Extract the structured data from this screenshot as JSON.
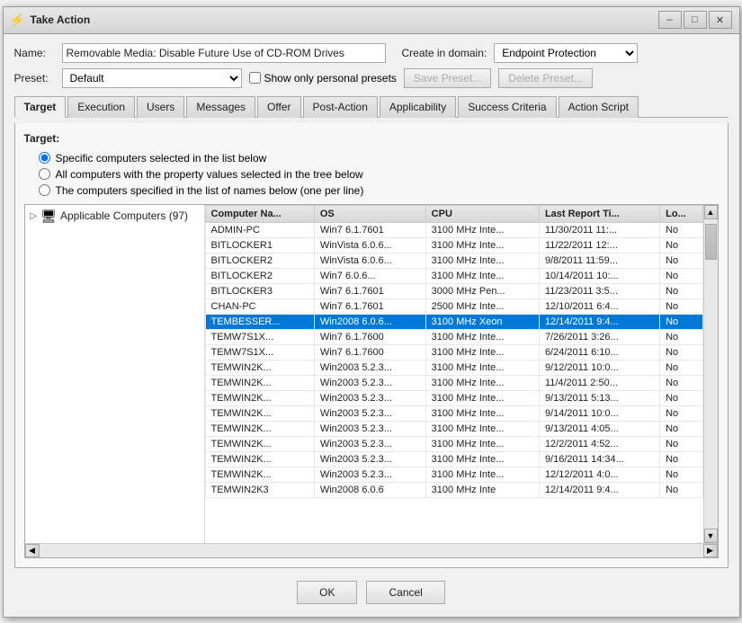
{
  "window": {
    "title": "Take Action",
    "icon": "⚡"
  },
  "form": {
    "name_label": "Name:",
    "name_value": "Removable Media: Disable Future Use of CD-ROM Drives",
    "domain_label": "Create in domain:",
    "domain_value": "Endpoint Protection",
    "preset_label": "Preset:",
    "preset_value": "Default",
    "show_personal_label": "Show only personal presets",
    "save_preset_label": "Save Preset...",
    "delete_preset_label": "Delete Preset..."
  },
  "tabs": [
    {
      "id": "target",
      "label": "Target",
      "active": true
    },
    {
      "id": "execution",
      "label": "Execution",
      "active": false
    },
    {
      "id": "users",
      "label": "Users",
      "active": false
    },
    {
      "id": "messages",
      "label": "Messages",
      "active": false
    },
    {
      "id": "offer",
      "label": "Offer",
      "active": false
    },
    {
      "id": "post-action",
      "label": "Post-Action",
      "active": false
    },
    {
      "id": "applicability",
      "label": "Applicability",
      "active": false
    },
    {
      "id": "success-criteria",
      "label": "Success Criteria",
      "active": false
    },
    {
      "id": "action-script",
      "label": "Action Script",
      "active": false
    }
  ],
  "target_tab": {
    "section_label": "Target:",
    "radio1": "Specific computers selected in the list below",
    "radio2": "All computers with the property values selected in the tree below",
    "radio3": "The computers specified in the list of names below (one per line)",
    "tree": {
      "node_label": "Applicable Computers (97)",
      "expand_icon": "▷",
      "folder_icon": "🖥"
    },
    "table": {
      "columns": [
        "Computer Na...",
        "OS",
        "CPU",
        "Last Report Ti...",
        "Lo..."
      ],
      "rows": [
        {
          "computer": "ADMIN-PC",
          "os": "Win7 6.1.7601",
          "cpu": "3100 MHz Inte...",
          "last_report": "11/30/2011 11:...",
          "lo": "No",
          "highlight": false
        },
        {
          "computer": "BITLOCKER1",
          "os": "WinVista 6.0.6...",
          "cpu": "3100 MHz Inte...",
          "last_report": "11/22/2011 12:...",
          "lo": "No",
          "highlight": false
        },
        {
          "computer": "BITLOCKER2",
          "os": "WinVista 6.0.6...",
          "cpu": "3100 MHz Inte...",
          "last_report": "9/8/2011 11:59...",
          "lo": "No",
          "highlight": false
        },
        {
          "computer": "BITLOCKER2",
          "os": "Win7 6.0.6...",
          "cpu": "3100 MHz Inte...",
          "last_report": "10/14/2011 10:...",
          "lo": "No",
          "highlight": false
        },
        {
          "computer": "BITLOCKER3",
          "os": "Win7 6.1.7601",
          "cpu": "3000 MHz Pen...",
          "last_report": "11/23/2011 3:5...",
          "lo": "No",
          "highlight": false
        },
        {
          "computer": "CHAN-PC",
          "os": "Win7 6.1.7601",
          "cpu": "2500 MHz Inte...",
          "last_report": "12/10/2011 6:4...",
          "lo": "No",
          "highlight": false
        },
        {
          "computer": "TEMBESSER...",
          "os": "Win2008 6.0.6...",
          "cpu": "3100 MHz Xeon",
          "last_report": "12/14/2011 9:4...",
          "lo": "No",
          "highlight": true
        },
        {
          "computer": "TEMW7S1X...",
          "os": "Win7 6.1.7600",
          "cpu": "3100 MHz Inte...",
          "last_report": "7/26/2011 3:26...",
          "lo": "No",
          "highlight": false
        },
        {
          "computer": "TEMW7S1X...",
          "os": "Win7 6.1.7600",
          "cpu": "3100 MHz Inte...",
          "last_report": "6/24/2011 6:10...",
          "lo": "No",
          "highlight": false
        },
        {
          "computer": "TEMWIN2K...",
          "os": "Win2003 5.2.3...",
          "cpu": "3100 MHz Inte...",
          "last_report": "9/12/2011 10:0...",
          "lo": "No",
          "highlight": false
        },
        {
          "computer": "TEMWIN2K...",
          "os": "Win2003 5.2.3...",
          "cpu": "3100 MHz Inte...",
          "last_report": "11/4/2011 2:50...",
          "lo": "No",
          "highlight": false
        },
        {
          "computer": "TEMWIN2K...",
          "os": "Win2003 5.2.3...",
          "cpu": "3100 MHz Inte...",
          "last_report": "9/13/2011 5:13...",
          "lo": "No",
          "highlight": false
        },
        {
          "computer": "TEMWIN2K...",
          "os": "Win2003 5.2.3...",
          "cpu": "3100 MHz Inte...",
          "last_report": "9/14/2011 10:0...",
          "lo": "No",
          "highlight": false
        },
        {
          "computer": "TEMWIN2K...",
          "os": "Win2003 5.2.3...",
          "cpu": "3100 MHz Inte...",
          "last_report": "9/13/2011 4:05...",
          "lo": "No",
          "highlight": false
        },
        {
          "computer": "TEMWIN2K...",
          "os": "Win2003 5.2.3...",
          "cpu": "3100 MHz Inte...",
          "last_report": "12/2/2011 4:52...",
          "lo": "No",
          "highlight": false
        },
        {
          "computer": "TEMWIN2K...",
          "os": "Win2003 5.2.3...",
          "cpu": "3100 MHz Inte...",
          "last_report": "9/16/2011 14:34...",
          "lo": "No",
          "highlight": false
        },
        {
          "computer": "TEMWIN2K...",
          "os": "Win2003 5.2.3...",
          "cpu": "3100 MHz Inte...",
          "last_report": "12/12/2011 4:0...",
          "lo": "No",
          "highlight": false
        },
        {
          "computer": "TEMWIN2K3",
          "os": "Win2008 6.0.6",
          "cpu": "3100 MHz Inte",
          "last_report": "12/14/2011 9:4...",
          "lo": "No",
          "highlight": false
        }
      ]
    }
  },
  "buttons": {
    "ok": "OK",
    "cancel": "Cancel"
  }
}
